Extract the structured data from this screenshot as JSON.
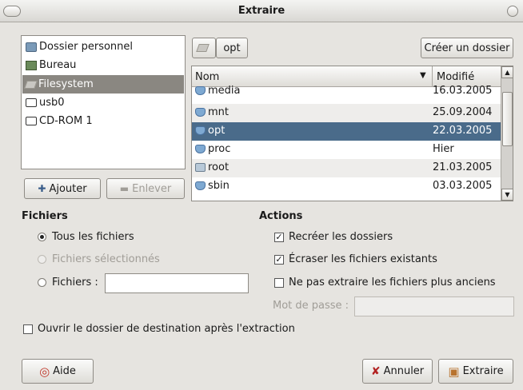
{
  "window": {
    "title": "Extraire"
  },
  "places": [
    {
      "label": "Dossier personnel",
      "icon": "home-folder-icon"
    },
    {
      "label": "Bureau",
      "icon": "desktop-icon"
    },
    {
      "label": "Filesystem",
      "icon": "filesystem-icon"
    },
    {
      "label": "usb0",
      "icon": "drive-icon"
    },
    {
      "label": "CD-ROM 1",
      "icon": "cdrom-icon"
    }
  ],
  "places_buttons": {
    "add": "Ajouter",
    "remove": "Enlever"
  },
  "pathbar": {
    "current": "opt",
    "create_folder": "Créer un dossier"
  },
  "filelist": {
    "columns": {
      "name": "Nom",
      "modified": "Modifié"
    },
    "rows": [
      {
        "name": "media",
        "modified": "16.03.2005"
      },
      {
        "name": "mnt",
        "modified": "25.09.2004"
      },
      {
        "name": "opt",
        "modified": "22.03.2005"
      },
      {
        "name": "proc",
        "modified": "Hier"
      },
      {
        "name": "root",
        "modified": "21.03.2005"
      },
      {
        "name": "sbin",
        "modified": "03.03.2005"
      }
    ],
    "selected": "opt"
  },
  "files_section": {
    "title": "Fichiers",
    "all_files": "Tous les fichiers",
    "selected_files": "Fichiers sélectionnés",
    "files_pattern": "Fichiers :",
    "files_pattern_value": ""
  },
  "actions_section": {
    "title": "Actions",
    "recreate_folders": "Recréer les dossiers",
    "overwrite": "Écraser les fichiers existants",
    "no_older": "Ne pas extraire les fichiers plus anciens",
    "password_label": "Mot de passe :",
    "password_value": ""
  },
  "open_destination": "Ouvrir le dossier de destination après l'extraction",
  "buttons": {
    "help": "Aide",
    "cancel": "Annuler",
    "extract": "Extraire"
  },
  "colors": {
    "selection": "#4a6b8a",
    "window_bg": "#e6e4e0"
  }
}
